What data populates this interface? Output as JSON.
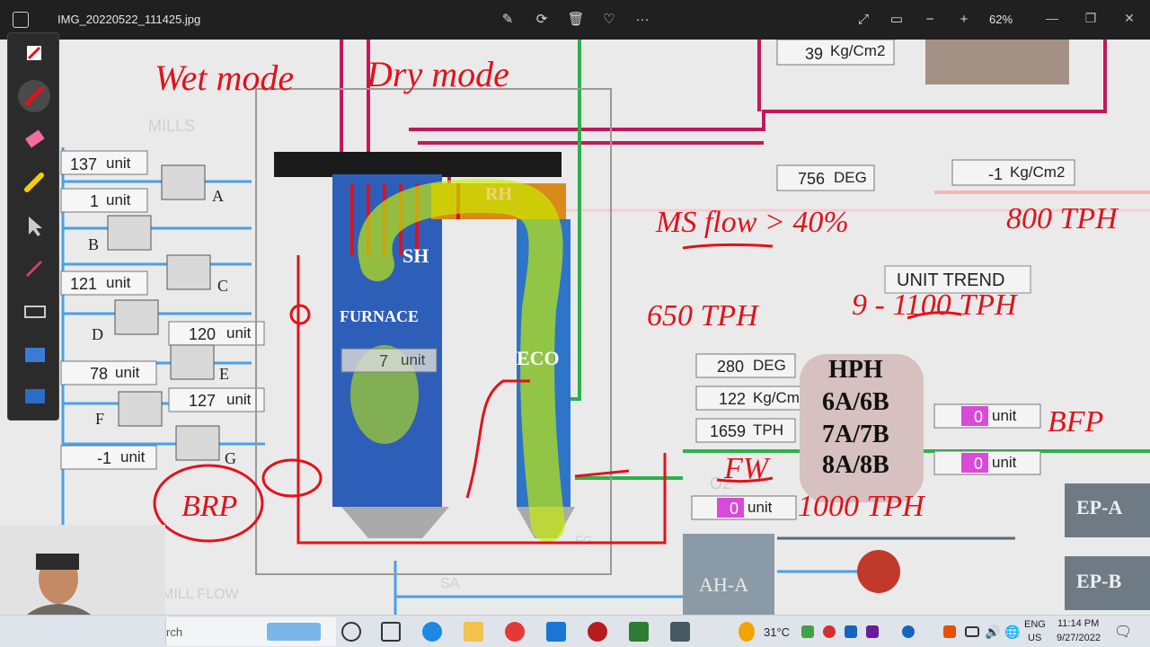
{
  "titlebar": {
    "filename": "IMG_20220522_111425.jpg",
    "zoom": "62%",
    "actions": [
      "edit-icon",
      "rotate-icon",
      "delete-icon",
      "favorite-icon",
      "more-icon"
    ],
    "more": "···"
  },
  "photo": {
    "handwriting": {
      "wet_mode": "Wet mode",
      "dry_mode": "Dry mode",
      "ms_flow": "MS flow > 40%",
      "ms_flow_value": "800 TPH",
      "value_650": "650 TPH",
      "value_range": "9 - 1100 TPH",
      "fw": "FW",
      "fw_flow": "1000 TPH",
      "bfp": "BFP",
      "brp": "BRP"
    },
    "scada": {
      "mills_label": "MILLS",
      "units": [
        {
          "value": "137",
          "unit": "unit"
        },
        {
          "value": "1",
          "unit": "unit"
        },
        {
          "value": "121",
          "unit": "unit"
        },
        {
          "value": "120",
          "unit": "unit"
        },
        {
          "value": "78",
          "unit": "unit"
        },
        {
          "value": "127",
          "unit": "unit"
        },
        {
          "value": "-1",
          "unit": "unit"
        }
      ],
      "mill_letters": [
        "A",
        "B",
        "C",
        "D",
        "E",
        "F",
        "G"
      ],
      "top_pressure": {
        "value": "39",
        "unit": "Kg/Cm2"
      },
      "temp_756": {
        "value": "756",
        "unit": "DEG"
      },
      "right_pressure": {
        "value": "-1",
        "unit": "Kg/Cm2"
      },
      "unit_trend": "UNIT TREND",
      "sh": "SH",
      "rh": "RH",
      "furnace": "FURNACE",
      "furnace_value": {
        "value": "7",
        "unit": "unit"
      },
      "eco": "ECO",
      "temp_280": {
        "value": "280",
        "unit": "DEG"
      },
      "pressure_122": {
        "value": "122",
        "unit": "Kg/Cm2"
      },
      "flow_1659": {
        "value": "1659",
        "unit": "TPH"
      },
      "hph": [
        "HPH",
        "6A/6B",
        "7A/7B",
        "8A/8B"
      ],
      "bfp_units": [
        {
          "value": "0",
          "unit": "unit"
        },
        {
          "value": "0",
          "unit": "unit"
        }
      ],
      "fw_unit": {
        "value": "0",
        "unit": "unit"
      },
      "ah_a": "AH-A",
      "ep_a": "EP-A",
      "ep_b": "EP-B",
      "o2": "O2",
      "mill_flow": "MILL FLOW",
      "sa": "SA",
      "fg": "FG"
    }
  },
  "taskbar": {
    "search_placeholder": "rch",
    "weather": "31°C",
    "lang": "ENG",
    "region": "US",
    "time": "11:14 PM",
    "date": "9/27/2022"
  },
  "colors": {
    "pen_red": "#e1121b",
    "highlight": "#c8f000",
    "boiler_blue": "#2e5fb8",
    "steam_pipe": "#c2185b",
    "water_pipe": "#2bb24c"
  }
}
